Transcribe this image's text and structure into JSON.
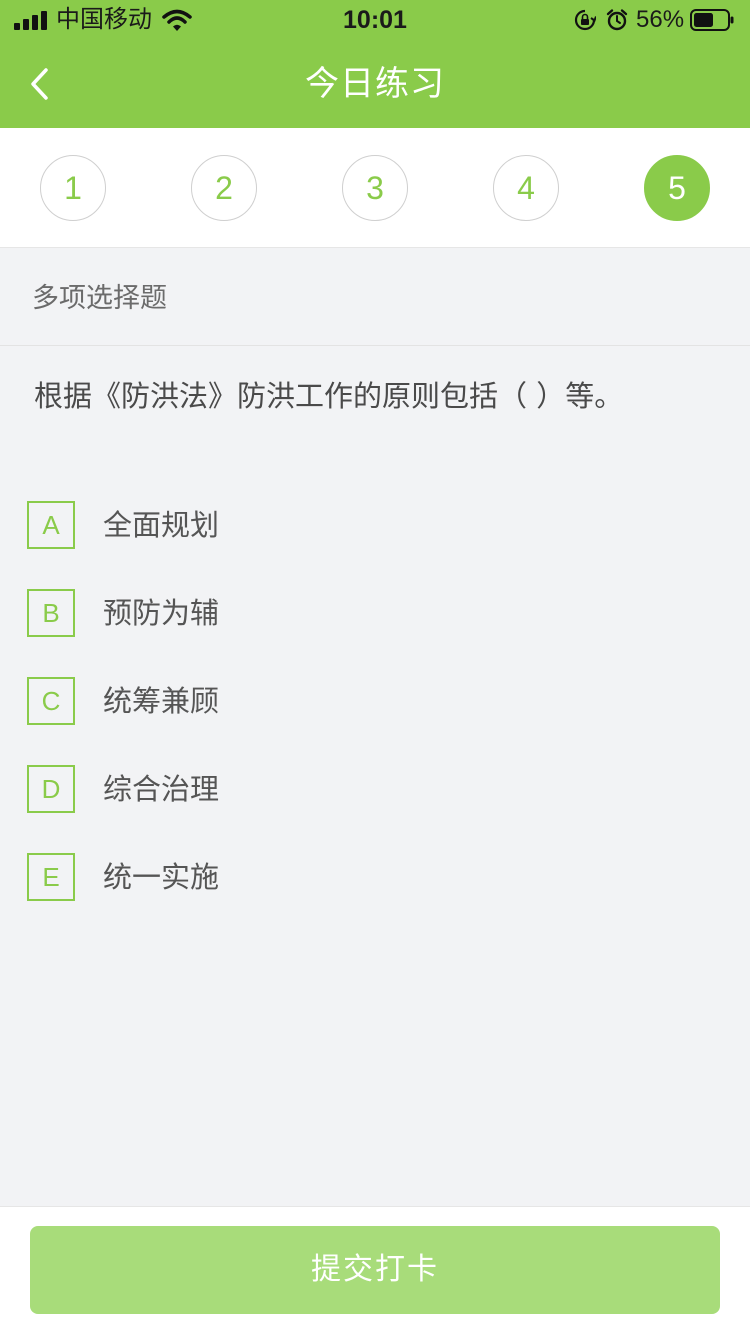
{
  "status_bar": {
    "carrier": "中国移动",
    "time": "10:01",
    "battery_percent": "56%",
    "icons": [
      "signal-icon",
      "wifi-icon",
      "orientation-lock-icon",
      "alarm-icon",
      "battery-icon"
    ]
  },
  "nav": {
    "title": "今日练习",
    "back_icon": "chevron-left-icon"
  },
  "question_tabs": {
    "items": [
      "1",
      "2",
      "3",
      "4",
      "5"
    ],
    "active": "5"
  },
  "question": {
    "type_label": "多项选择题",
    "text": "根据《防洪法》防洪工作的原则包括（    ）等。",
    "options": [
      {
        "letter": "A",
        "text": "全面规划"
      },
      {
        "letter": "B",
        "text": "预防为辅"
      },
      {
        "letter": "C",
        "text": "统筹兼顾"
      },
      {
        "letter": "D",
        "text": "综合治理"
      },
      {
        "letter": "E",
        "text": "统一实施"
      }
    ]
  },
  "footer": {
    "submit_label": "提交打卡"
  },
  "colors": {
    "brand_green": "#8acb4a",
    "button_green_disabled": "#a8dc7a",
    "page_background": "#f2f3f5"
  }
}
